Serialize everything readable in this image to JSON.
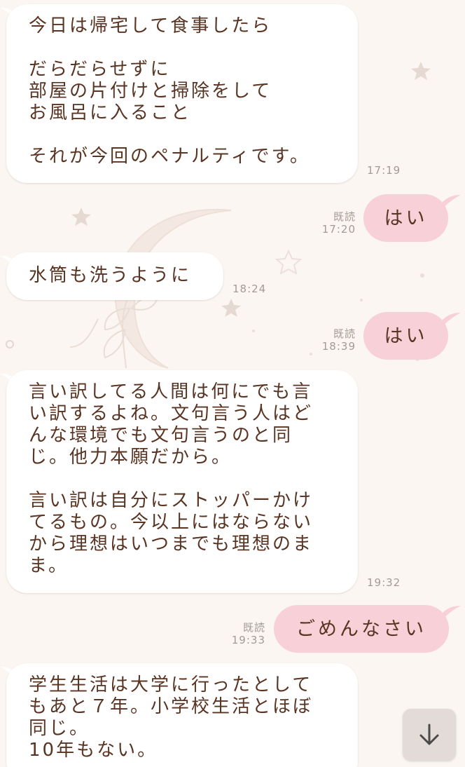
{
  "messages": [
    {
      "dir": "in",
      "text": "今日は帰宅して食事したら\n\nだらだらせずに\n部屋の片付けと掃除をして\nお風呂に入ること\n\nそれが今回のペナルティです。",
      "time": "17:19"
    },
    {
      "dir": "out",
      "text": "はい",
      "read": "既読",
      "time": "17:20"
    },
    {
      "dir": "in",
      "text": "水筒も洗うように",
      "time": "18:24"
    },
    {
      "dir": "out",
      "text": "はい",
      "read": "既読",
      "time": "18:39"
    },
    {
      "dir": "in",
      "text": "言い訳してる人間は何にでも言\nい訳するよね。文句言う人はど\nんな環境でも文句言うのと同\nじ。他力本願だから。\n\n言い訳は自分にストッパーかけ\nてるもの。今以上にはならない\nから理想はいつまでも理想のま\nま。",
      "time": "19:32"
    },
    {
      "dir": "out",
      "text": "ごめんなさい",
      "read": "既読",
      "time": "19:33"
    },
    {
      "dir": "in",
      "text": "学生生活は大学に行ったとして\nもあと７年。小学校生活とほぼ\n同じ。\n10年もない。",
      "time": ""
    }
  ],
  "scroll_button": {
    "icon": "arrow-down-icon"
  },
  "colors": {
    "background": "#fbf6f2",
    "incoming_bubble": "#ffffff",
    "outgoing_bubble": "#f7d0d8",
    "message_text": "#5a3422",
    "meta_text": "#a59a93"
  }
}
